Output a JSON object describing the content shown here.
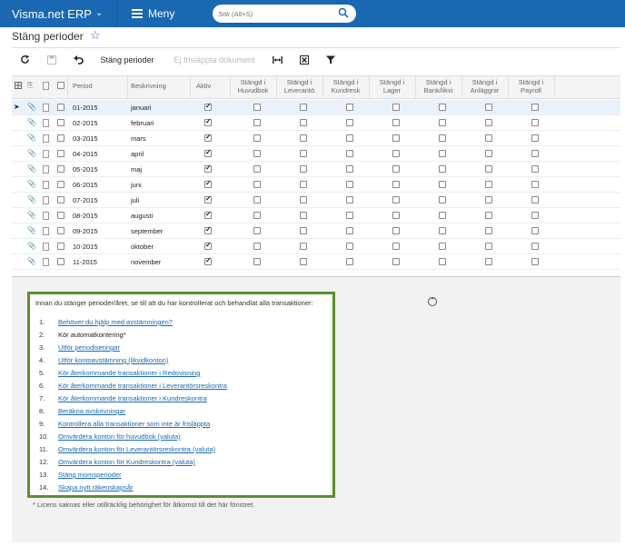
{
  "topbar": {
    "brand": "Visma.net ERP",
    "menu_label": "Meny",
    "search_placeholder": "Sök (Alt+S)"
  },
  "page": {
    "title": "Stäng perioder"
  },
  "toolbar": {
    "close_periods_label": "Stäng perioder",
    "unreleased_label": "Ej frisläppta dokument"
  },
  "grid": {
    "columns": {
      "period": "Period",
      "description": "Beskrivning",
      "active": "Aktiv",
      "gl": [
        "Stängd i",
        "Huvudbok"
      ],
      "ap": [
        "Stängd i",
        "Leverantö"
      ],
      "ar": [
        "Stängd i",
        "Kundresk"
      ],
      "inv": [
        "Stängd i",
        "Lager"
      ],
      "cash": [
        "Stängd i",
        "Bank/likvi"
      ],
      "fa": [
        "Stängd i",
        "Anläggnir"
      ],
      "pay": [
        "Stängd i",
        "Payroll"
      ]
    },
    "rows": [
      {
        "period": "01-2015",
        "description": "januari",
        "active": true
      },
      {
        "period": "02-2015",
        "description": "februari",
        "active": true
      },
      {
        "period": "03-2015",
        "description": "mars",
        "active": true
      },
      {
        "period": "04-2015",
        "description": "april",
        "active": true
      },
      {
        "period": "05-2015",
        "description": "maj",
        "active": true
      },
      {
        "period": "06-2015",
        "description": "juni",
        "active": true
      },
      {
        "period": "07-2015",
        "description": "juli",
        "active": true
      },
      {
        "period": "08-2015",
        "description": "augusti",
        "active": true
      },
      {
        "period": "09-2015",
        "description": "september",
        "active": true
      },
      {
        "period": "10-2015",
        "description": "oktober",
        "active": true
      },
      {
        "period": "11-2015",
        "description": "november",
        "active": true
      }
    ]
  },
  "info": {
    "intro": "Innan du stänger perioder/året, se till att du har kontrollerat och behandlat alla transaktioner:",
    "items": [
      {
        "num": "1.",
        "label": "Behöver du hjälp med avstämningen?",
        "link": true
      },
      {
        "num": "2.",
        "label": "Kör automatkontering*",
        "link": false
      },
      {
        "num": "3.",
        "label": "Utför periodiseringar",
        "link": true
      },
      {
        "num": "4.",
        "label": "Utför kontoavstämning (likvidkonton)",
        "link": true
      },
      {
        "num": "5.",
        "label": "Kör återkommande transaktioner i Redovisning",
        "link": true
      },
      {
        "num": "6.",
        "label": "Kör återkommande transaktioner i Leverantörsreskontra",
        "link": true
      },
      {
        "num": "7.",
        "label": "Kör återkommande transaktioner i Kundreskontra",
        "link": true
      },
      {
        "num": "8.",
        "label": "Beräkna avskrivningar",
        "link": true
      },
      {
        "num": "9.",
        "label": "Kontrollera alla transaktioner som inte är frisläppta",
        "link": true
      },
      {
        "num": "10.",
        "label": "Omvärdera konton för huvudbok (valuta)",
        "link": true
      },
      {
        "num": "11.",
        "label": "Omvärdera konton för Leverantörsreskontra (valuta)",
        "link": true
      },
      {
        "num": "12.",
        "label": "Omvärdera konton för Kundreskontra (valuta)",
        "link": true
      },
      {
        "num": "13.",
        "label": "Stäng momsperioder",
        "link": true
      },
      {
        "num": "14.",
        "label": "Skapa nytt räkenskapsår",
        "link": true
      }
    ],
    "footnote": "* Licens saknas eller otillräcklig behörighet för åtkomst till det här fönstret."
  },
  "colors": {
    "topbar": "#1a68b2",
    "link": "#1a68b2",
    "info_border": "#5a8f2e"
  }
}
